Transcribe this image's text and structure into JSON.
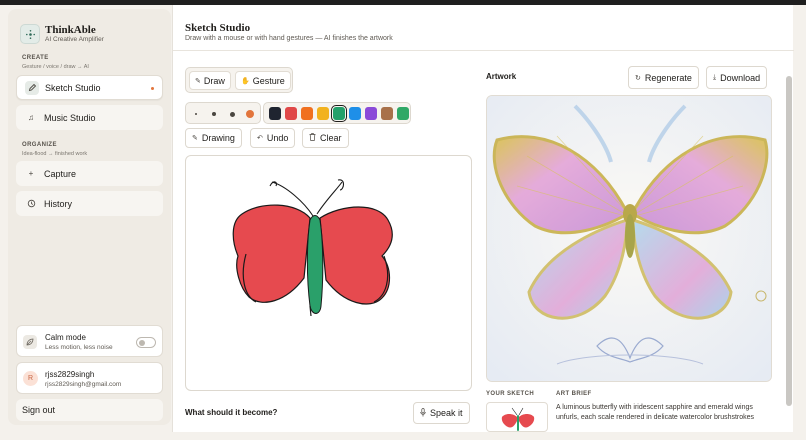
{
  "app": {
    "name": "ThinkAble",
    "tagline": "AI Creative Amplifier"
  },
  "sidebar": {
    "create_title": "CREATE",
    "create_sub": "Gesture / voice / draw → AI",
    "create_items": [
      {
        "label": "Sketch Studio",
        "icon": "pencil-icon",
        "active": true
      },
      {
        "label": "Music Studio",
        "icon": "music-note-icon",
        "active": false
      }
    ],
    "organize_title": "ORGANIZE",
    "organize_sub": "Idea-flood → finished work",
    "organize_items": [
      {
        "label": "Capture",
        "icon": "plus-icon"
      },
      {
        "label": "History",
        "icon": "history-icon"
      }
    ],
    "calm_mode": {
      "title": "Calm mode",
      "subtitle": "Less motion, less noise",
      "enabled": false
    },
    "user": {
      "initial": "R",
      "name": "rjss2829singh",
      "email": "rjss2829singh@gmail.com"
    },
    "sign_out": "Sign out"
  },
  "main": {
    "title": "Sketch Studio",
    "subtitle": "Draw with a mouse or with hand gestures — AI finishes the artwork",
    "mode_tabs": [
      {
        "label": "Draw",
        "icon": "pencil-icon",
        "selected": true
      },
      {
        "label": "Gesture",
        "icon": "hand-icon",
        "selected": false
      }
    ],
    "brush_sizes": [
      "small",
      "medium",
      "large",
      "extra-large"
    ],
    "colors": [
      "#1f2430",
      "#e04848",
      "#f0701f",
      "#f2b21e",
      "#23a06a",
      "#1e8fe8",
      "#8b4ad8",
      "#a8714a",
      "#2fa866"
    ],
    "selected_color_index": 4,
    "actions": {
      "drawing": "Drawing",
      "undo": "Undo",
      "clear": "Clear"
    },
    "prompt_label": "What should it become?",
    "speak_button": "Speak it"
  },
  "artwork": {
    "label": "Artwork",
    "regenerate": "Regenerate",
    "download": "Download",
    "your_sketch_label": "YOUR SKETCH",
    "art_brief_label": "ART BRIEF",
    "art_brief": "A luminous butterfly with iridescent sapphire and emerald wings unfurls, each scale rendered in delicate watercolor brushstrokes"
  }
}
